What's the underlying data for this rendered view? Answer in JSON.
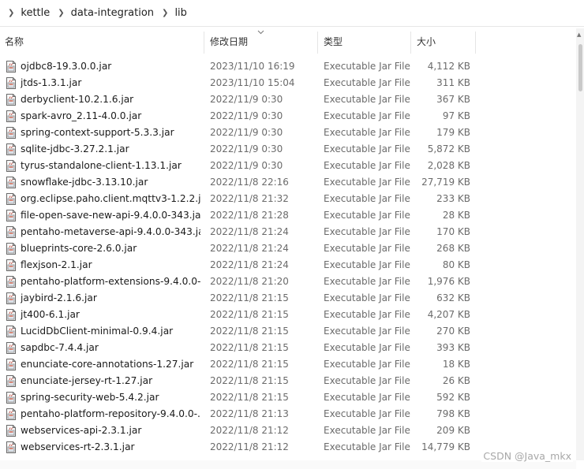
{
  "breadcrumb": [
    "kettle",
    "data-integration",
    "lib"
  ],
  "columns": {
    "name": "名称",
    "modified": "修改日期",
    "type": "类型",
    "size": "大小"
  },
  "files": [
    {
      "name": "ojdbc8-19.3.0.0.jar",
      "modified": "2023/11/10 16:19",
      "type": "Executable Jar File",
      "size": "4,112 KB"
    },
    {
      "name": "jtds-1.3.1.jar",
      "modified": "2023/11/10 15:04",
      "type": "Executable Jar File",
      "size": "311 KB"
    },
    {
      "name": "derbyclient-10.2.1.6.jar",
      "modified": "2022/11/9 0:30",
      "type": "Executable Jar File",
      "size": "367 KB"
    },
    {
      "name": "spark-avro_2.11-4.0.0.jar",
      "modified": "2022/11/9 0:30",
      "type": "Executable Jar File",
      "size": "97 KB"
    },
    {
      "name": "spring-context-support-5.3.3.jar",
      "modified": "2022/11/9 0:30",
      "type": "Executable Jar File",
      "size": "179 KB"
    },
    {
      "name": "sqlite-jdbc-3.27.2.1.jar",
      "modified": "2022/11/9 0:30",
      "type": "Executable Jar File",
      "size": "5,872 KB"
    },
    {
      "name": "tyrus-standalone-client-1.13.1.jar",
      "modified": "2022/11/9 0:30",
      "type": "Executable Jar File",
      "size": "2,028 KB"
    },
    {
      "name": "snowflake-jdbc-3.13.10.jar",
      "modified": "2022/11/8 22:16",
      "type": "Executable Jar File",
      "size": "27,719 KB"
    },
    {
      "name": "org.eclipse.paho.client.mqttv3-1.2.2.jar",
      "modified": "2022/11/8 21:32",
      "type": "Executable Jar File",
      "size": "233 KB"
    },
    {
      "name": "file-open-save-new-api-9.4.0.0-343.jar",
      "modified": "2022/11/8 21:28",
      "type": "Executable Jar File",
      "size": "28 KB"
    },
    {
      "name": "pentaho-metaverse-api-9.4.0.0-343.jar",
      "modified": "2022/11/8 21:24",
      "type": "Executable Jar File",
      "size": "170 KB"
    },
    {
      "name": "blueprints-core-2.6.0.jar",
      "modified": "2022/11/8 21:24",
      "type": "Executable Jar File",
      "size": "268 KB"
    },
    {
      "name": "flexjson-2.1.jar",
      "modified": "2022/11/8 21:24",
      "type": "Executable Jar File",
      "size": "80 KB"
    },
    {
      "name": "pentaho-platform-extensions-9.4.0.0-...",
      "modified": "2022/11/8 21:20",
      "type": "Executable Jar File",
      "size": "1,976 KB"
    },
    {
      "name": "jaybird-2.1.6.jar",
      "modified": "2022/11/8 21:15",
      "type": "Executable Jar File",
      "size": "632 KB"
    },
    {
      "name": "jt400-6.1.jar",
      "modified": "2022/11/8 21:15",
      "type": "Executable Jar File",
      "size": "4,207 KB"
    },
    {
      "name": "LucidDbClient-minimal-0.9.4.jar",
      "modified": "2022/11/8 21:15",
      "type": "Executable Jar File",
      "size": "270 KB"
    },
    {
      "name": "sapdbc-7.4.4.jar",
      "modified": "2022/11/8 21:15",
      "type": "Executable Jar File",
      "size": "393 KB"
    },
    {
      "name": "enunciate-core-annotations-1.27.jar",
      "modified": "2022/11/8 21:15",
      "type": "Executable Jar File",
      "size": "18 KB"
    },
    {
      "name": "enunciate-jersey-rt-1.27.jar",
      "modified": "2022/11/8 21:15",
      "type": "Executable Jar File",
      "size": "26 KB"
    },
    {
      "name": "spring-security-web-5.4.2.jar",
      "modified": "2022/11/8 21:15",
      "type": "Executable Jar File",
      "size": "592 KB"
    },
    {
      "name": "pentaho-platform-repository-9.4.0.0-...",
      "modified": "2022/11/8 21:13",
      "type": "Executable Jar File",
      "size": "798 KB"
    },
    {
      "name": "webservices-api-2.3.1.jar",
      "modified": "2022/11/8 21:12",
      "type": "Executable Jar File",
      "size": "209 KB"
    },
    {
      "name": "webservices-rt-2.3.1.jar",
      "modified": "2022/11/8 21:12",
      "type": "Executable Jar File",
      "size": "14,779 KB"
    }
  ],
  "watermark": "CSDN @Java_mkx",
  "icons": {
    "file": "jar-file-icon",
    "separator": "chevron-right-icon",
    "sort": "sort-descending-icon"
  }
}
